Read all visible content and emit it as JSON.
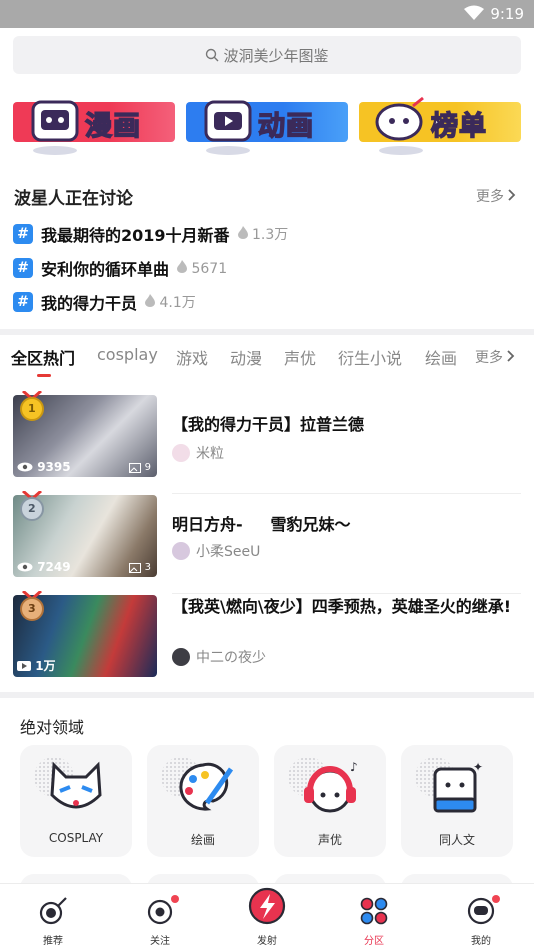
{
  "status": {
    "time": "9:19"
  },
  "search": {
    "placeholder": "波洞美少年图鉴"
  },
  "banners": [
    {
      "label": "漫画",
      "color": "#ef3a56"
    },
    {
      "label": "动画",
      "color": "#2d7df0"
    },
    {
      "label": "榜单",
      "color": "#f6c324"
    }
  ],
  "discussion": {
    "title": "波星人正在讨论",
    "more": "更多",
    "topics": [
      {
        "title": "我最期待的2019十月新番",
        "heat": "1.3万"
      },
      {
        "title": "安利你的循环单曲",
        "heat": "5671"
      },
      {
        "title": "我的得力干员",
        "heat": "4.1万"
      }
    ]
  },
  "tabs": {
    "items": [
      "全区热门",
      "cosplay",
      "游戏",
      "动漫",
      "声优",
      "衍生小说",
      "绘画"
    ],
    "more": "更多",
    "active": 0
  },
  "posts": [
    {
      "rank": "1",
      "title": "【我的得力干员】拉普兰德",
      "author": "米粒",
      "views": "9395",
      "images": "9"
    },
    {
      "rank": "2",
      "title": "明日方舟-     雪豹兄妹～",
      "author": "小柔SeeU",
      "views": "7249",
      "images": "3"
    },
    {
      "rank": "3",
      "title": "【我英\\燃向\\夜少】四季预热，英雄圣火的继承!",
      "author": "中二の夜少",
      "views": "1万",
      "images": ""
    }
  ],
  "domains": {
    "title": "绝对领域",
    "items": [
      {
        "label": "COSPLAY",
        "icon": "fox-mask-icon"
      },
      {
        "label": "绘画",
        "icon": "palette-icon"
      },
      {
        "label": "声优",
        "icon": "headphones-girl-icon"
      },
      {
        "label": "同人文",
        "icon": "book-icon"
      }
    ]
  },
  "nav": [
    {
      "label": "推荐",
      "icon": "rocket-astronaut-icon",
      "badge": false
    },
    {
      "label": "关注",
      "icon": "eye-planet-icon",
      "badge": true
    },
    {
      "label": "发射",
      "icon": "lightning-launch-icon",
      "badge": false
    },
    {
      "label": "分区",
      "icon": "grid-dots-icon",
      "badge": false,
      "active": true
    },
    {
      "label": "我的",
      "icon": "astronaut-icon",
      "badge": true
    }
  ],
  "colors": {
    "accent": "#e53935",
    "hash": "#2d8bf0",
    "active_nav": "#e8334f"
  }
}
